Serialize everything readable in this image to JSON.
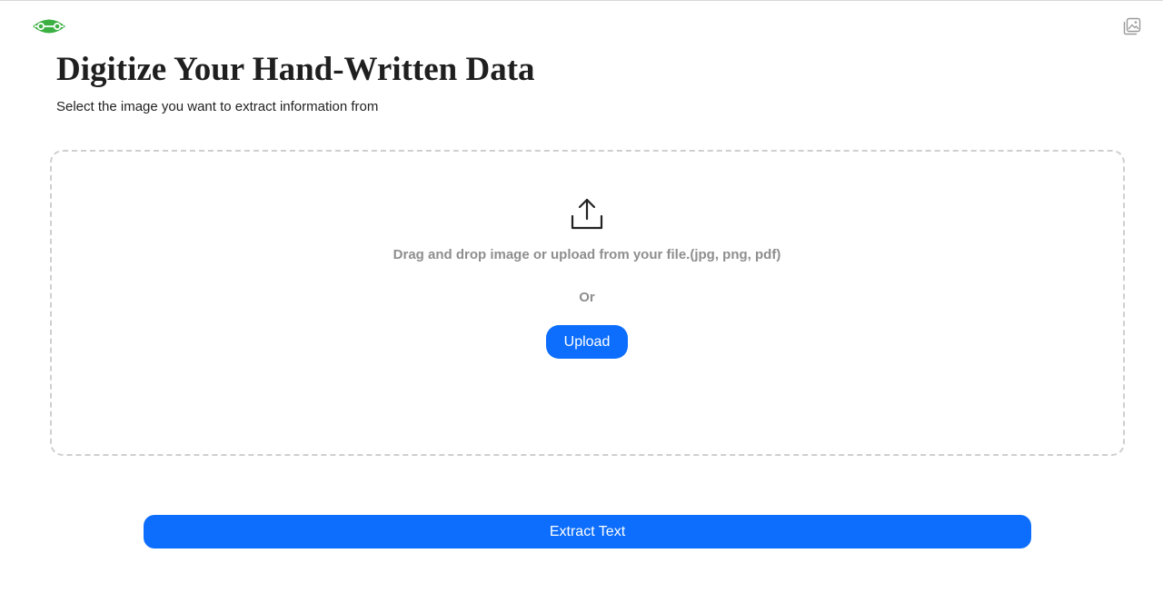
{
  "header": {
    "logo_icon": "eye-logo-icon",
    "top_right_icon": "image-gallery-icon"
  },
  "main": {
    "title": "Digitize Your Hand-Written Data",
    "subtitle": "Select the image you want to extract information from"
  },
  "dropzone": {
    "icon": "upload-icon",
    "instruction": "Drag and drop image or upload from your file.(jpg, png, pdf)",
    "or_label": "Or",
    "upload_label": "Upload"
  },
  "actions": {
    "extract_label": "Extract Text"
  },
  "colors": {
    "accent": "#0d6efd",
    "logo_green": "#3cb043",
    "muted_text": "#8e8e8e",
    "border": "#cfcfcf"
  }
}
